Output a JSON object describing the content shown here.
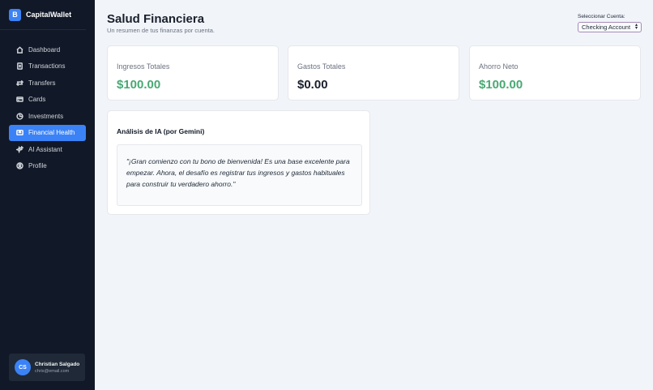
{
  "brand": {
    "logo_letter": "B",
    "name": "CapitalWallet",
    "accent": "#3b82f6"
  },
  "sidebar": {
    "items": [
      {
        "label": "Dashboard",
        "icon": "home-icon",
        "active": false
      },
      {
        "label": "Transactions",
        "icon": "document-icon",
        "active": false
      },
      {
        "label": "Transfers",
        "icon": "arrows-swap-icon",
        "active": false
      },
      {
        "label": "Cards",
        "icon": "credit-card-icon",
        "active": false
      },
      {
        "label": "Investments",
        "icon": "chart-pie-icon",
        "active": false
      },
      {
        "label": "Financial Health",
        "icon": "monitor-icon",
        "active": true
      },
      {
        "label": "AI Assistant",
        "icon": "sparkles-icon",
        "active": false
      },
      {
        "label": "Profile",
        "icon": "user-circle-icon",
        "active": false
      }
    ]
  },
  "user": {
    "initials": "CS",
    "name": "Christian Salgado",
    "email": "chris@email.com"
  },
  "header": {
    "title": "Salud Financiera",
    "subtitle": "Un resumen de tus finanzas por cuenta.",
    "account_label": "Seleccionar Cuenta:",
    "account_selected": "Checking Account"
  },
  "stats": [
    {
      "label": "Ingresos Totales",
      "value": "$100.00",
      "color": "#48a874"
    },
    {
      "label": "Gastos Totales",
      "value": "$0.00",
      "color": "#1a202c"
    },
    {
      "label": "Ahorro Neto",
      "value": "$100.00",
      "color": "#48a874"
    }
  ],
  "ai": {
    "title": "Análisis de IA (por Gemini)",
    "message": "\"¡Gran comienzo con tu bono de bienvenida! Es una base excelente para empezar. Ahora, el desafío es registrar tus ingresos y gastos habituales para construir tu verdadero ahorro.\""
  }
}
